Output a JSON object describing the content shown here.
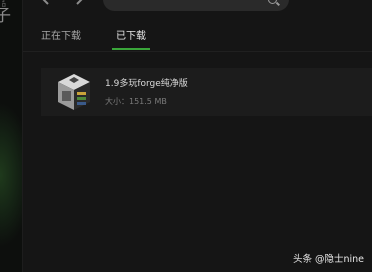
{
  "sidebar": {
    "partial_glyph_top": "品",
    "partial_glyph": "子"
  },
  "toolbar": {
    "back_icon": "arrow-left",
    "forward_icon": "arrow-right",
    "search_icon": "search"
  },
  "tabs": [
    {
      "label": "正在下载",
      "active": false
    },
    {
      "label": "已下载",
      "active": true
    }
  ],
  "downloads": [
    {
      "name": "1.9多玩forge纯净版",
      "size_label": "大小：151.5 MB",
      "icon": "package-cube-icon"
    }
  ],
  "watermark": {
    "text": "头条 @隐士nine"
  },
  "colors": {
    "accent": "#3aa63a",
    "background": "#151515",
    "item_background": "#1c1c1c"
  }
}
